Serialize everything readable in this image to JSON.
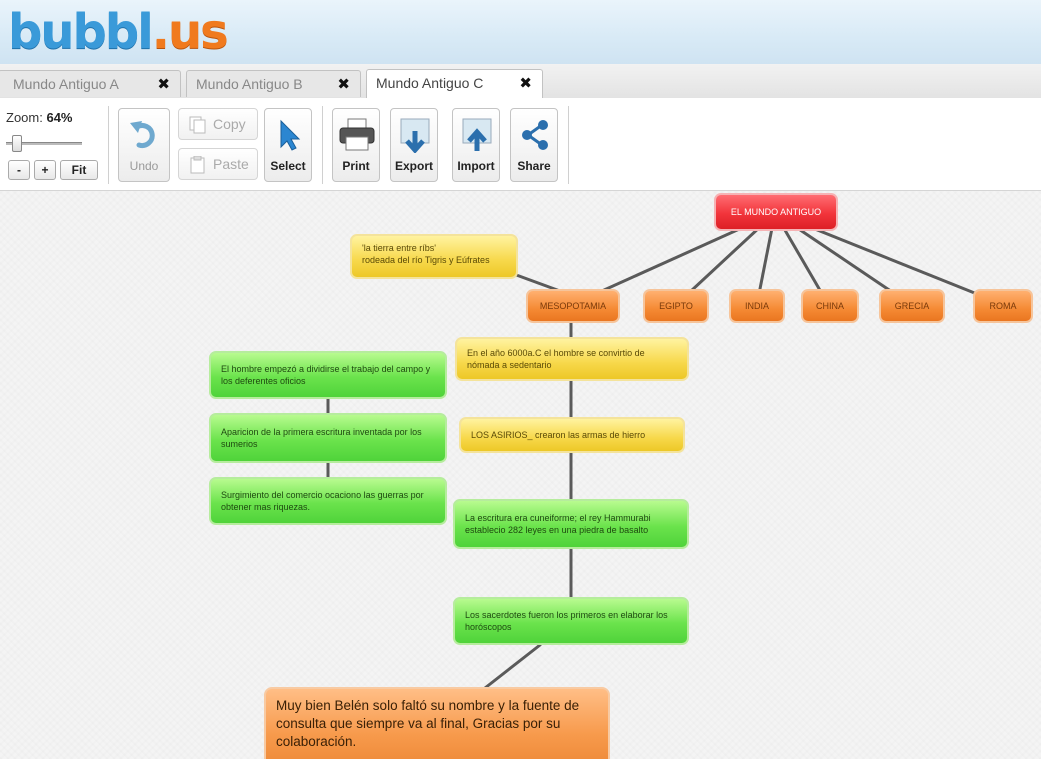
{
  "app": {
    "logo_part1": "bubbl",
    "logo_dot": ".",
    "logo_part2": "us"
  },
  "tabs": [
    {
      "label": "Mundo Antiguo A",
      "close": "✖",
      "active": false
    },
    {
      "label": "Mundo Antiguo B",
      "close": "✖",
      "active": false
    },
    {
      "label": "Mundo Antiguo C",
      "close": "✖",
      "active": true
    }
  ],
  "toolbar": {
    "zoom_prefix": "Zoom: ",
    "zoom_value": "64%",
    "zoom_fraction": 0.64,
    "zoom_out": "-",
    "zoom_in": "+",
    "fit": "Fit",
    "undo": "Undo",
    "copy": "Copy",
    "paste": "Paste",
    "select": "Select",
    "print": "Print",
    "export": "Export",
    "import": "Import",
    "share": "Share"
  },
  "colors": {
    "root": "#f2343b",
    "country": "#f58a34",
    "yellow": "#f7d84a",
    "green": "#6be34c",
    "link": "#5a5a5a",
    "logo_blue": "#3a9ad9",
    "logo_orange": "#f07a1e"
  },
  "mindmap": {
    "root": "EL MUNDO ANTIGUO",
    "countries": [
      "MESOPOTAMIA",
      "EGIPTO",
      "INDIA",
      "CHINA",
      "GRECIA",
      "ROMA"
    ],
    "mesopotamia_note": {
      "line1": "'la tierra entre ríbs'",
      "line2": "rodeada del río Tigris y Eúfrates"
    },
    "sedentario": "En el año 6000a.C el hombre se convirtio de nómada a sedentario",
    "asirios": "LOS ASIRIOS_ crearon las armas de  hierro",
    "escritura": "La escritura era cuneiforme; el rey Hammurabi establecio 282 leyes en una piedra de basalto",
    "sacerdotes": "Los sacerdotes fueron los primeros en elaborar los horóscopos",
    "trabajo": "El hombre empezó a dividirse el trabajo del campo y los deferentes oficios",
    "aparicion": "Aparicion de la primera escritura inventada por los sumerios",
    "comercio": "Surgimiento del comercio ocaciono las guerras por obtener mas riquezas.",
    "comment": "Muy bien Belén solo faltó su nombre y la fuente de consulta que siempre va al final, Gracias por su colaboración."
  }
}
